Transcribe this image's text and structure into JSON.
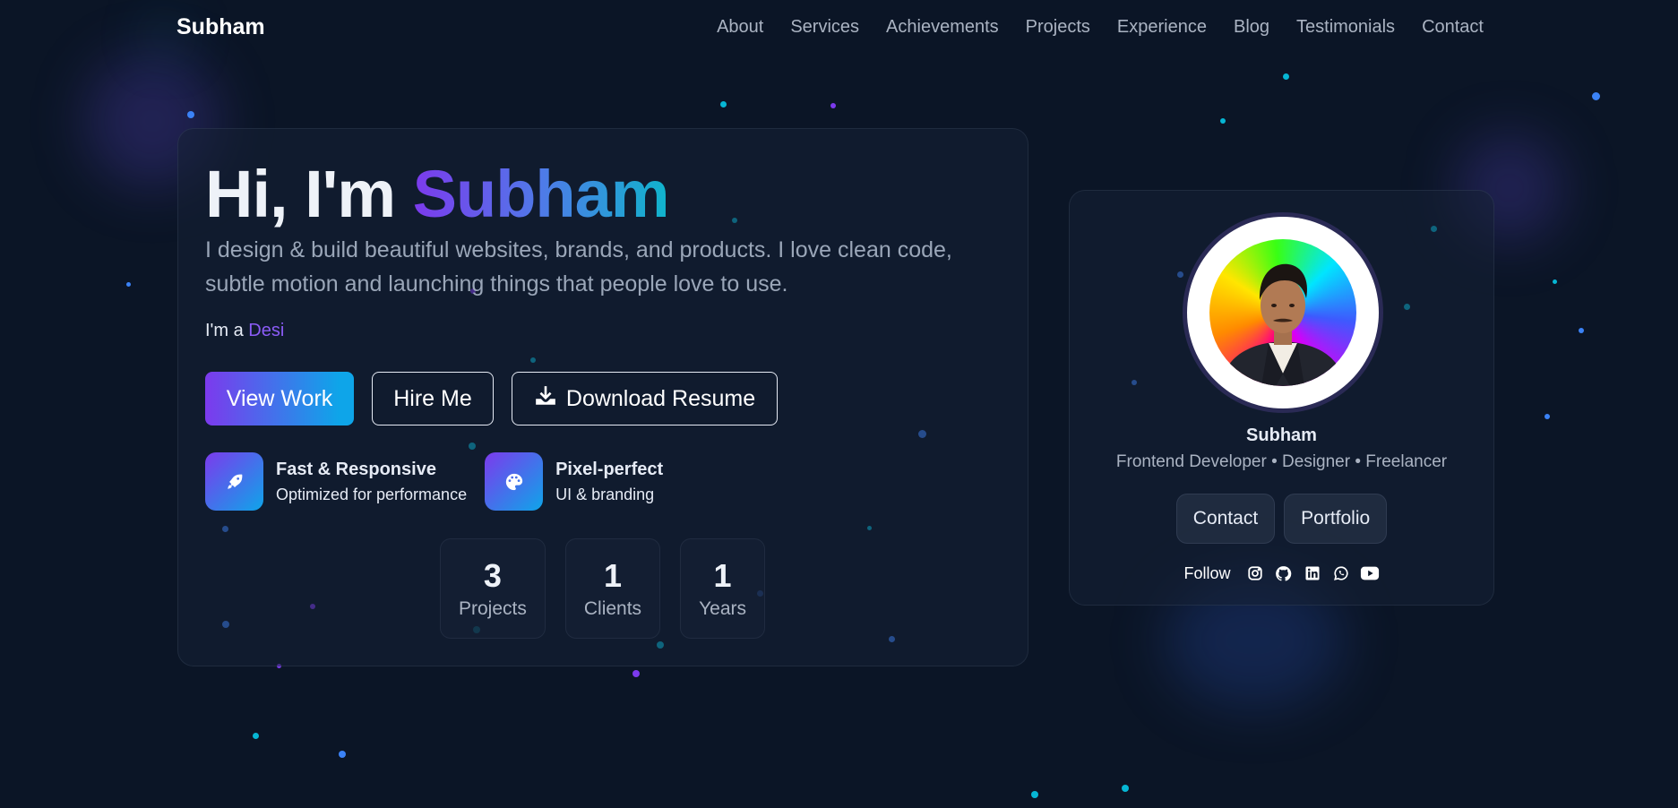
{
  "nav": {
    "brand": "Subham",
    "links": [
      "About",
      "Services",
      "Achievements",
      "Projects",
      "Experience",
      "Blog",
      "Testimonials",
      "Contact"
    ]
  },
  "hero": {
    "greeting": "Hi, I'm ",
    "name": "Subham",
    "description": "I design & build beautiful websites, brands, and products. I love clean code, subtle motion and launching things that people love to use.",
    "iam_prefix": "I'm a ",
    "iam_word": "Desi",
    "buttons": {
      "view_work": "View Work",
      "hire_me": "Hire Me",
      "download_resume": "Download Resume"
    },
    "features": [
      {
        "icon": "rocket-icon",
        "title": "Fast & Responsive",
        "subtitle": "Optimized for performance"
      },
      {
        "icon": "palette-icon",
        "title": "Pixel-perfect",
        "subtitle": "UI & branding"
      }
    ],
    "stats": [
      {
        "value": "3",
        "label": "Projects"
      },
      {
        "value": "1",
        "label": "Clients"
      },
      {
        "value": "1",
        "label": "Years"
      }
    ]
  },
  "profile": {
    "name": "Subham",
    "role": "Frontend Developer • Designer • Freelancer",
    "contact_button": "Contact",
    "portfolio_button": "Portfolio",
    "follow_label": "Follow",
    "socials": [
      "instagram-icon",
      "github-icon",
      "linkedin-icon",
      "whatsapp-icon",
      "youtube-icon"
    ]
  },
  "colors": {
    "background": "#0b1526",
    "accent_purple": "#7c3aed",
    "accent_cyan": "#0ea5e9"
  }
}
